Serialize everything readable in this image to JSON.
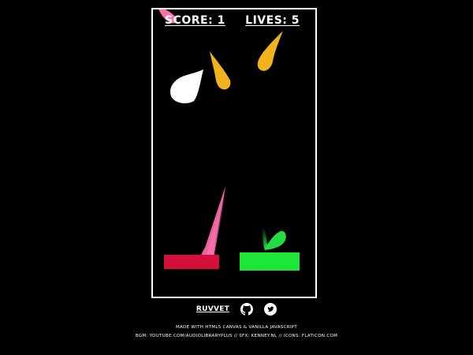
{
  "hud": {
    "score_text": "SCORE: 1",
    "lives_text": "LIVES: 5"
  },
  "game": {
    "drops": [
      {
        "color": "#ff6fb0",
        "kind": "pink-drop",
        "state": "falling"
      },
      {
        "color": "#ffffff",
        "kind": "white-drop",
        "state": "falling"
      },
      {
        "color": "#f2b21c",
        "kind": "yellow-drop",
        "state": "falling"
      },
      {
        "color": "#f2b21c",
        "kind": "yellow-drop",
        "state": "falling"
      },
      {
        "color": "#ff6fb0",
        "kind": "pink-drop",
        "state": "streaking"
      },
      {
        "color": "#22dd44",
        "kind": "green-drop",
        "state": "caught"
      }
    ],
    "buckets": [
      {
        "color": "#d4103a",
        "kind": "red-bucket"
      },
      {
        "color": "#1ee636",
        "kind": "green-bucket"
      }
    ]
  },
  "footer": {
    "author": "RUVVET",
    "icons": [
      "github-icon",
      "twitter-icon"
    ],
    "made_with": "MADE WITH HTML5 CANVAS & VANILLA JAVASCRIPT",
    "credits": "BGM: YOUTUBE.COM/AUDIOLIBRARYPLUS // SFX: KENNEY.NL // ICONS: FLATICON.COM"
  }
}
